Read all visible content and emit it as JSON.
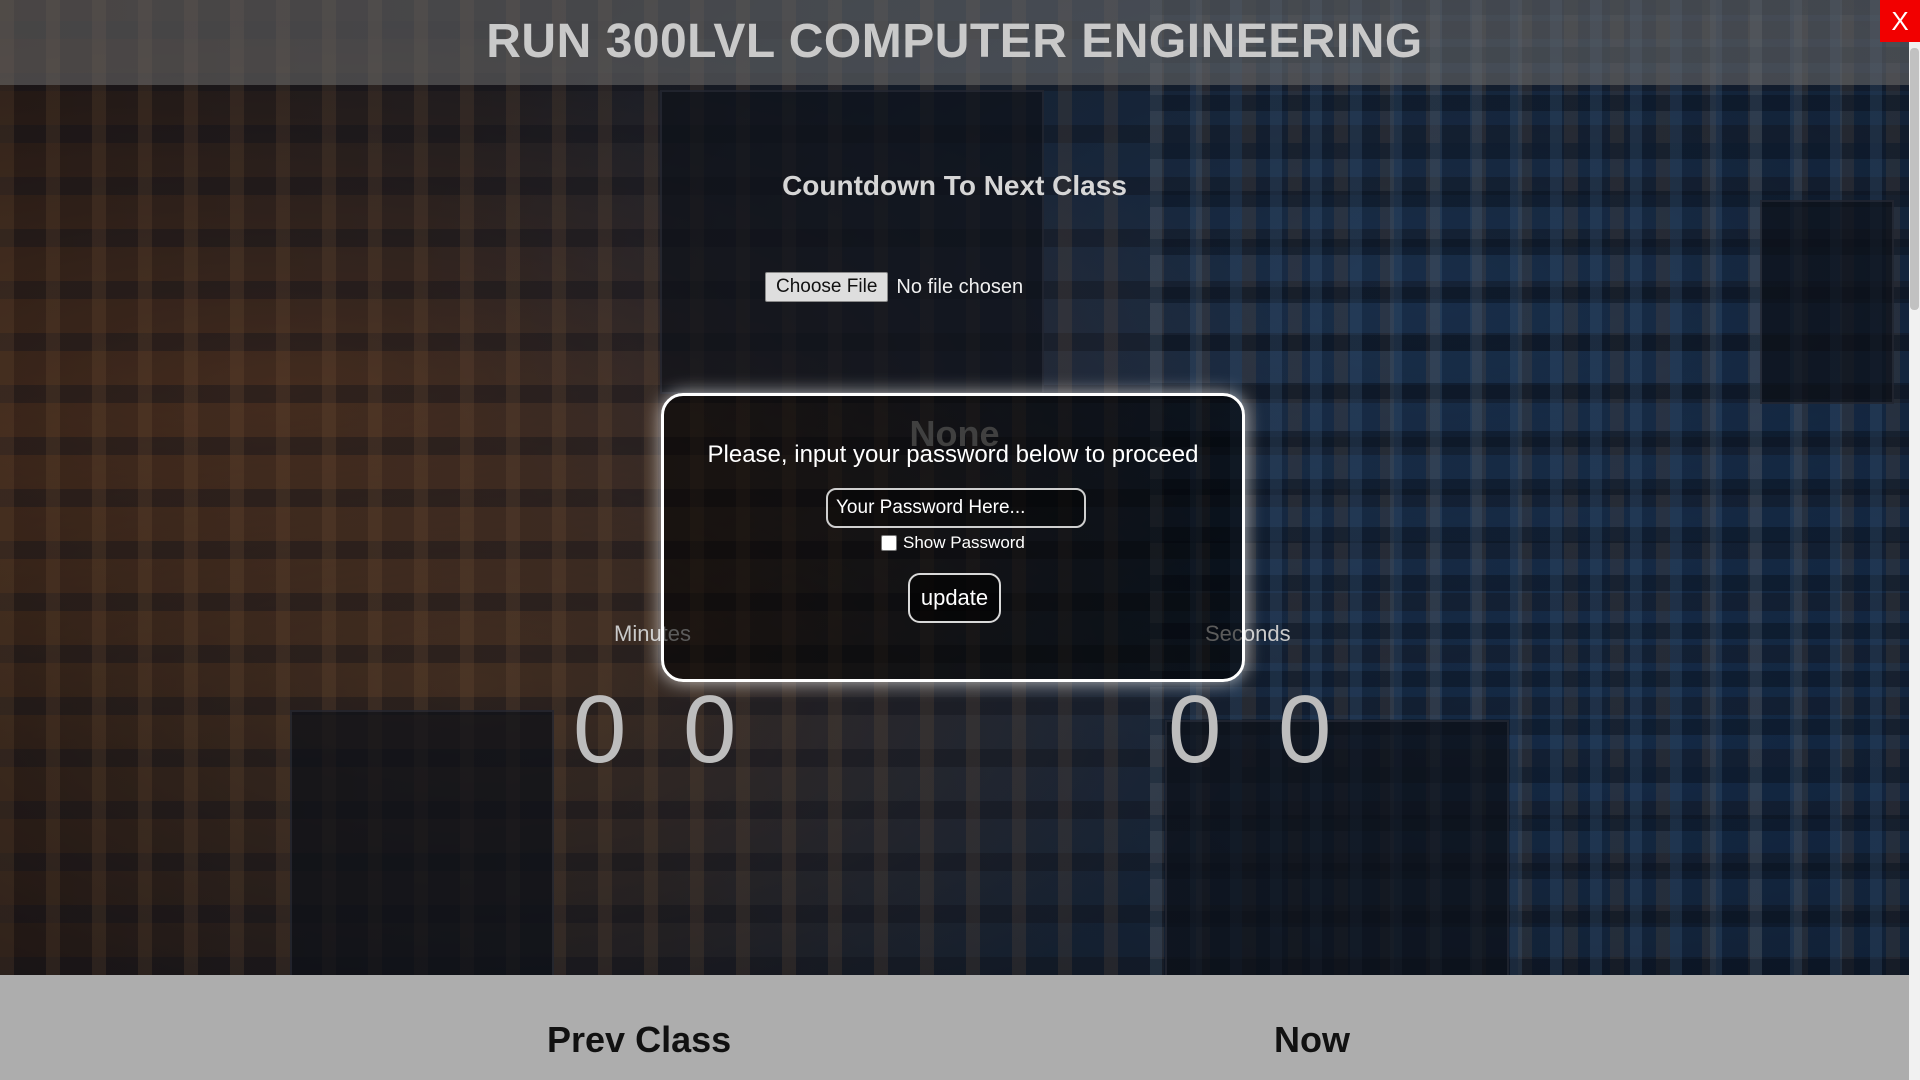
{
  "header": {
    "title": "RUN 300LVL COMPUTER ENGINEERING",
    "close_label": "X"
  },
  "countdown": {
    "heading": "Countdown To Next Class",
    "current_subject": "None",
    "minutes_label": "Minutes",
    "seconds_label": "Seconds",
    "minutes_digits": [
      "0",
      "0"
    ],
    "seconds_digits": [
      "0",
      "0"
    ]
  },
  "file_upload": {
    "button_label": "Choose File",
    "status": "No file chosen"
  },
  "modal": {
    "message": "Please, input your password below to proceed",
    "password_placeholder": "Your Password Here...",
    "password_value": "",
    "show_password_label": "Show Password",
    "show_password_checked": false,
    "submit_label": "update"
  },
  "schedule": {
    "prev_label": "Prev Class",
    "now_label": "Now"
  },
  "colors": {
    "header_bar": "#6e6e6e",
    "close_button": "#f20000",
    "modal_border": "#ffffff",
    "bottom_panel": "#adadad"
  }
}
